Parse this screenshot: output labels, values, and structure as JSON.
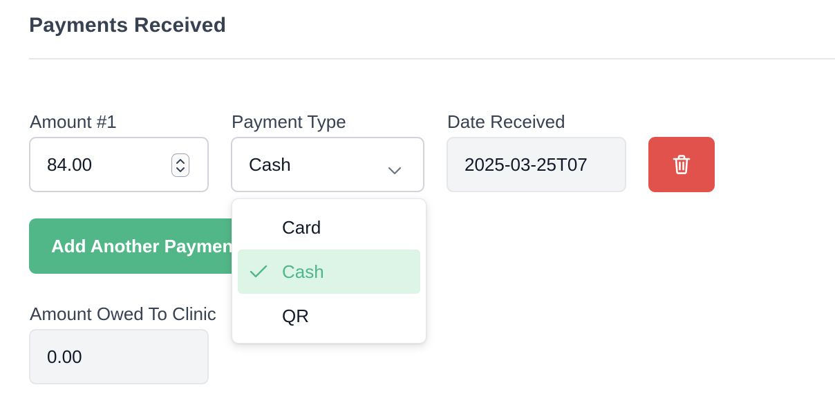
{
  "section": {
    "title": "Payments Received"
  },
  "payment": {
    "amount_label": "Amount #1",
    "amount_value": "84.00",
    "type_label": "Payment Type",
    "type_value": "Cash",
    "date_label": "Date Received",
    "date_value": "2025-03-25T07"
  },
  "dropdown": {
    "options": [
      {
        "label": "Card",
        "selected": false
      },
      {
        "label": "Cash",
        "selected": true
      },
      {
        "label": "QR",
        "selected": false
      }
    ]
  },
  "actions": {
    "add_label": "Add Another Payment"
  },
  "owed": {
    "label": "Amount Owed To Clinic",
    "value": "0.00"
  },
  "icons": {
    "delete": "trash-icon",
    "select": "chevron-down-icon",
    "spinner": "number-stepper-icon",
    "check": "check-icon"
  },
  "colors": {
    "danger": "#e0524b",
    "success": "#52b788",
    "selected_bg": "#dcf5e6"
  }
}
